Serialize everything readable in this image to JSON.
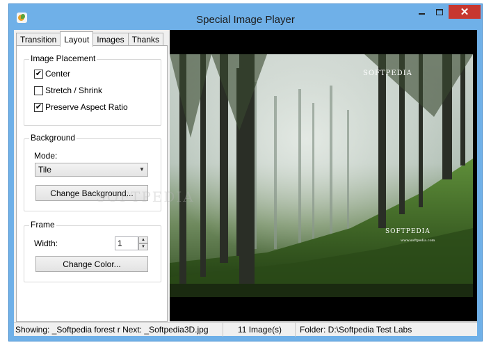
{
  "window": {
    "title": "Special Image Player",
    "close_glyph": "✕"
  },
  "tabs": [
    {
      "label": "Transition"
    },
    {
      "label": "Layout"
    },
    {
      "label": "Images"
    },
    {
      "label": "Thanks"
    }
  ],
  "layout": {
    "placement": {
      "title": "Image Placement",
      "center": {
        "label": "Center",
        "checked": true
      },
      "stretch": {
        "label": "Stretch / Shrink",
        "checked": false
      },
      "aspect": {
        "label": "Preserve Aspect Ratio",
        "checked": true
      }
    },
    "background": {
      "title": "Background",
      "mode_label": "Mode:",
      "mode_value": "Tile",
      "change_button": "Change Background..."
    },
    "frame": {
      "title": "Frame",
      "width_label": "Width:",
      "width_value": "1",
      "change_button": "Change Color..."
    }
  },
  "viewer": {
    "watermark_top": "SOFTPEDIA",
    "watermark_bottom": "SOFTPEDIA",
    "watermark_url": "www.softpedia.com"
  },
  "overlay_watermark": "SOFTPEDIA",
  "status": {
    "showing": "Showing:  _Softpedia forest r  Next:  _Softpedia3D.jpg",
    "count": "11 Image(s)",
    "folder": "Folder: D:\\Softpedia Test Labs"
  },
  "icons": {
    "app": "image-player-icon",
    "minimize": "minimize-icon",
    "maximize": "maximize-icon",
    "close": "close-icon",
    "dropdown": "chevron-down-icon",
    "spin_up": "spin-up-icon",
    "spin_down": "spin-down-icon"
  },
  "colors": {
    "titlebar": "#6fb0e8",
    "close": "#c7372f",
    "viewer_bg": "#000000"
  }
}
